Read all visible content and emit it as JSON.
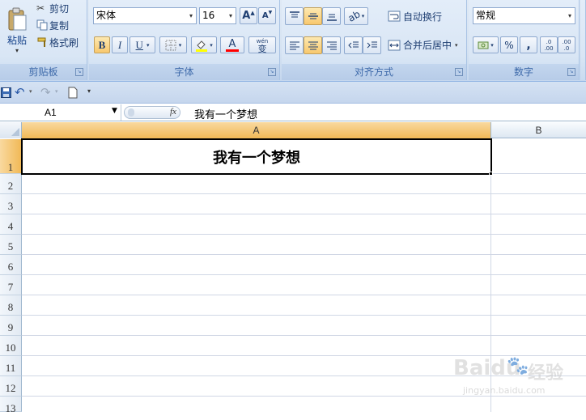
{
  "ribbon": {
    "clipboard": {
      "label": "剪贴板",
      "paste": "粘贴",
      "cut": "剪切",
      "copy": "复制",
      "format_painter": "格式刷"
    },
    "font": {
      "label": "字体",
      "font_name": "宋体",
      "font_size": "16",
      "grow": "A",
      "shrink": "A",
      "bold": "B",
      "italic": "I",
      "underline": "U",
      "font_color_glyph": "A",
      "phonetic_top": "wén",
      "phonetic_glyph": "变"
    },
    "alignment": {
      "label": "对齐方式",
      "wrap_text": "自动换行",
      "merge_center": "合并后居中"
    },
    "number": {
      "label": "数字",
      "format": "常规",
      "percent": "%",
      "comma": ",",
      "inc_decimal": ".0",
      "inc_decimal2": ".00",
      "dec_decimal": ".00",
      "dec_decimal2": ".0"
    }
  },
  "formula_bar": {
    "name_box": "A1",
    "fx": "fx",
    "content": "我有一个梦想"
  },
  "sheet": {
    "columns": [
      "A",
      "B"
    ],
    "rows": [
      "1",
      "2",
      "3",
      "4",
      "5",
      "6",
      "7",
      "8",
      "9",
      "10",
      "11",
      "12",
      "13"
    ],
    "a1_value": "我有一个梦想"
  },
  "watermark": {
    "brand": "Baidu",
    "label": "经验",
    "url": "jingyan.baidu.com"
  },
  "colors": {
    "ribbon_bg": "#dbe7f5",
    "active_button": "#f8c86e",
    "selected_header": "#f8c86e",
    "grid": "#d0d7e5",
    "highlight_yellow": "#ffff00",
    "font_red": "#ff0000"
  }
}
